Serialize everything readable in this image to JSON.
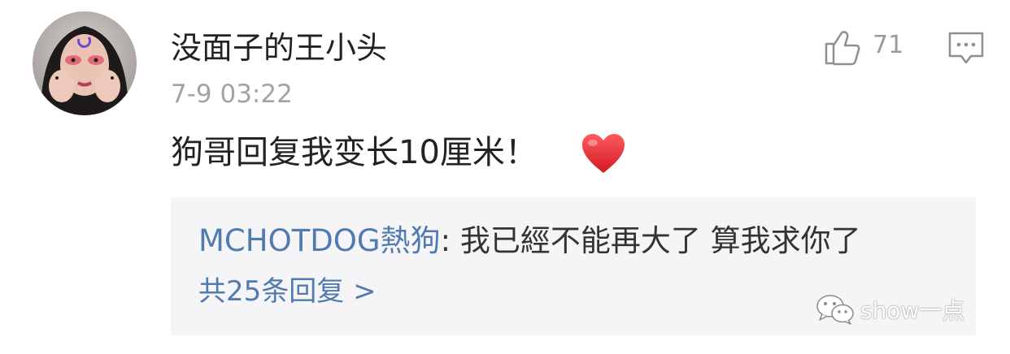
{
  "comment": {
    "username": "没面子的王小头",
    "timestamp": "7-9 03:22",
    "text": "狗哥回复我变长10厘米！",
    "like_count": "71",
    "avatar_icon": "user-avatar-photo",
    "like_icon": "thumbs-up-icon",
    "reply_icon": "comment-bubble-icon",
    "emoji_icon": "red-heart-icon"
  },
  "reply": {
    "author": "MCHOTDOG熱狗",
    "colon": ": ",
    "text": "我已經不能再大了 算我求你了",
    "count_label": "共25条回复 >"
  },
  "watermark": {
    "text": "show一点",
    "icon": "wechat-icon"
  },
  "colors": {
    "link": "#4f7bb0",
    "heart": "#e5262e",
    "muted": "#a3a3a3",
    "reply_bg": "#f5f5f7"
  }
}
